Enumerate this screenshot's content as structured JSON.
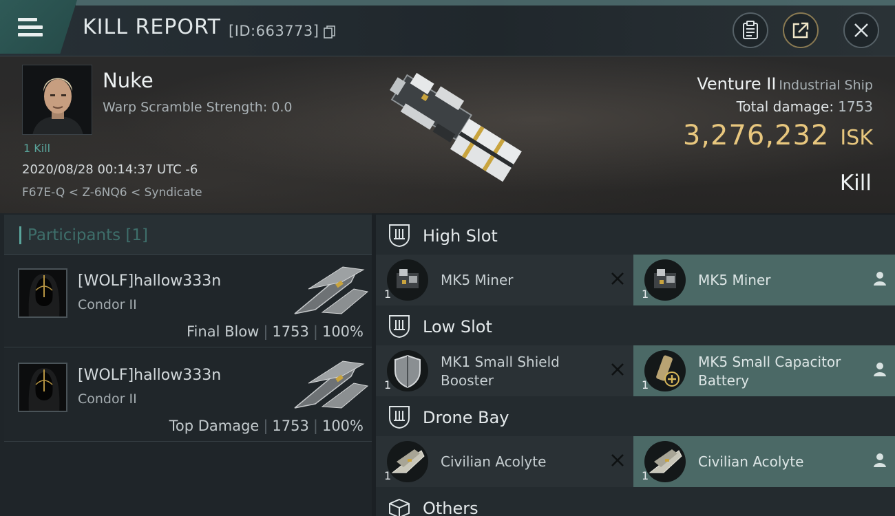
{
  "header": {
    "title": "KILL REPORT",
    "report_id": "[ID:663773]"
  },
  "victim": {
    "name": "Nuke",
    "warp_scramble": "Warp Scramble Strength: 0.0",
    "kills": "1 Kill",
    "timestamp": "2020/08/28 00:14:37 UTC -6",
    "location": "F67E-Q < Z-6NQ6 < Syndicate",
    "ship_name": "Venture II",
    "ship_class": "Industrial Ship",
    "damage_label": "Total damage:",
    "damage_value": "1753",
    "isk_value": "3,276,232",
    "isk_unit": "ISK",
    "result": "Kill"
  },
  "participants": {
    "label": "Participants [1]",
    "rows": [
      {
        "name": "[WOLF]hallow333n",
        "ship": "Condor II",
        "role": "Final Blow",
        "damage": "1753",
        "percent": "100%"
      },
      {
        "name": "[WOLF]hallow333n",
        "ship": "Condor II",
        "role": "Top Damage",
        "damage": "1753",
        "percent": "100%"
      }
    ]
  },
  "modules": {
    "high_slot": {
      "label": "High Slot",
      "destroyed": {
        "name": "MK5 Miner",
        "qty": "1"
      },
      "dropped": {
        "name": "MK5 Miner",
        "qty": "1"
      }
    },
    "low_slot": {
      "label": "Low Slot",
      "destroyed": {
        "name_line1": "MK1 Small Shield",
        "name_line2": "Booster",
        "qty": "1"
      },
      "dropped": {
        "name_line1": "MK5 Small Capacitor",
        "name_line2": "Battery",
        "qty": "1"
      }
    },
    "drone_bay": {
      "label": "Drone Bay",
      "destroyed": {
        "name": "Civilian Acolyte",
        "qty": "1"
      },
      "dropped": {
        "name": "Civilian Acolyte",
        "qty": "1"
      }
    },
    "others": {
      "label": "Others"
    }
  },
  "icons": {
    "menu": "menu-icon",
    "copy": "copy-icon",
    "clipboard": "clipboard-icon",
    "share": "share-icon",
    "close": "close-icon",
    "destroyed": "x-icon",
    "dropped": "person-icon",
    "slot": "slot-icon",
    "cargo": "box-icon"
  },
  "colors": {
    "accent_teal": "#5aa59c",
    "isk_gold": "#e8c77e",
    "dropped_bg": "#4b6966",
    "destroyed_bg": "#2a3135"
  }
}
